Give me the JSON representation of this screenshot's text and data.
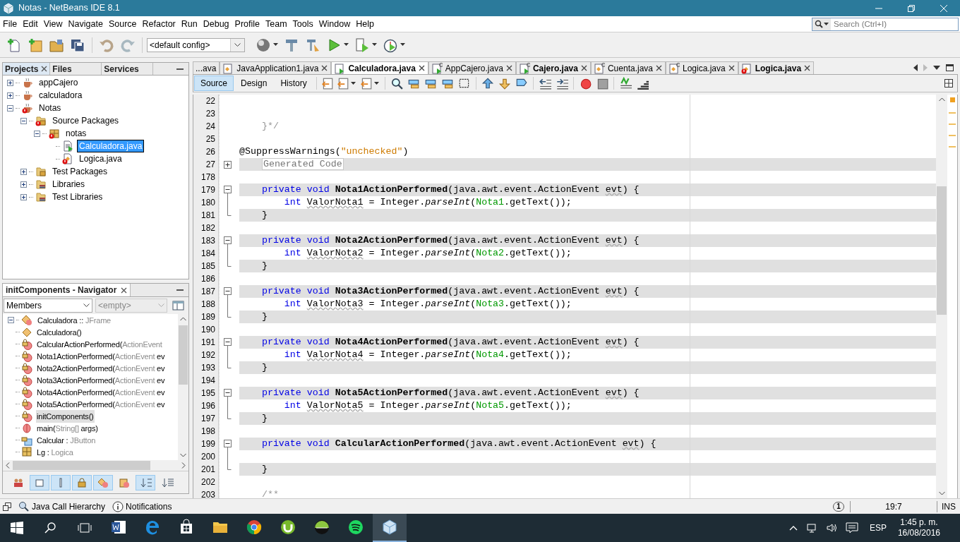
{
  "window": {
    "title": "Notas - NetBeans IDE 8.1"
  },
  "menu": [
    "File",
    "Edit",
    "View",
    "Navigate",
    "Source",
    "Refactor",
    "Run",
    "Debug",
    "Profile",
    "Team",
    "Tools",
    "Window",
    "Help"
  ],
  "search": {
    "placeholder": "Search (Ctrl+I)"
  },
  "toolbar": {
    "config": "<default config>"
  },
  "projects_panel": {
    "tabs": [
      {
        "label": "Projects",
        "selected": true
      },
      {
        "label": "Files",
        "selected": false
      },
      {
        "label": "Services",
        "selected": false
      }
    ],
    "tree": [
      {
        "label": "appCajero",
        "kind": "project",
        "expanded": false,
        "selected": false,
        "error": false
      },
      {
        "label": "calculadora",
        "kind": "project",
        "expanded": false,
        "selected": false,
        "error": false
      },
      {
        "label": "Notas",
        "kind": "project",
        "expanded": true,
        "selected": false,
        "error": true,
        "children": [
          {
            "label": "Source Packages",
            "kind": "source_packages",
            "expanded": true,
            "selected": false,
            "error": true,
            "children": [
              {
                "label": "notas",
                "kind": "package",
                "expanded": true,
                "selected": false,
                "error": true,
                "children": [
                  {
                    "label": "Calculadora.java",
                    "kind": "form",
                    "selected": true,
                    "error": false
                  },
                  {
                    "label": "Logica.java",
                    "kind": "java",
                    "selected": false,
                    "error": true
                  }
                ]
              }
            ]
          },
          {
            "label": "Test Packages",
            "kind": "test_packages",
            "expanded": false,
            "selected": false,
            "error": false
          },
          {
            "label": "Libraries",
            "kind": "libraries",
            "expanded": false,
            "selected": false,
            "error": false
          },
          {
            "label": "Test Libraries",
            "kind": "libraries",
            "expanded": false,
            "selected": false,
            "error": false
          }
        ]
      }
    ]
  },
  "navigator": {
    "title": "initComponents - Navigator",
    "filter": "Members",
    "secondary": "<empty>",
    "root": {
      "parts": [
        {
          "text": "Calculadora :: ",
          "kind": "plain"
        },
        {
          "text": "JFrame",
          "kind": "type"
        }
      ],
      "kind": "class",
      "expanded": true,
      "children": [
        {
          "parts": [
            {
              "text": "Calculadora()",
              "kind": "plain"
            }
          ],
          "kind": "constructor",
          "selected": false
        },
        {
          "parts": [
            {
              "text": "CalcularActionPerformed(",
              "kind": "plain"
            },
            {
              "text": "ActionEvent",
              "kind": "type"
            }
          ],
          "kind": "private_method",
          "selected": false
        },
        {
          "parts": [
            {
              "text": "Nota1ActionPerformed(",
              "kind": "plain"
            },
            {
              "text": "ActionEvent",
              "kind": "type"
            },
            {
              "text": " ev",
              "kind": "plain"
            }
          ],
          "kind": "private_method",
          "selected": false
        },
        {
          "parts": [
            {
              "text": "Nota2ActionPerformed(",
              "kind": "plain"
            },
            {
              "text": "ActionEvent",
              "kind": "type"
            },
            {
              "text": " ev",
              "kind": "plain"
            }
          ],
          "kind": "private_method",
          "selected": false
        },
        {
          "parts": [
            {
              "text": "Nota3ActionPerformed(",
              "kind": "plain"
            },
            {
              "text": "ActionEvent",
              "kind": "type"
            },
            {
              "text": " ev",
              "kind": "plain"
            }
          ],
          "kind": "private_method",
          "selected": false
        },
        {
          "parts": [
            {
              "text": "Nota4ActionPerformed(",
              "kind": "plain"
            },
            {
              "text": "ActionEvent",
              "kind": "type"
            },
            {
              "text": " ev",
              "kind": "plain"
            }
          ],
          "kind": "private_method",
          "selected": false
        },
        {
          "parts": [
            {
              "text": "Nota5ActionPerformed(",
              "kind": "plain"
            },
            {
              "text": "ActionEvent",
              "kind": "type"
            },
            {
              "text": " ev",
              "kind": "plain"
            }
          ],
          "kind": "private_method",
          "selected": false
        },
        {
          "parts": [
            {
              "text": "initComponents()",
              "kind": "plain"
            }
          ],
          "kind": "private_method",
          "selected": true
        },
        {
          "parts": [
            {
              "text": "main(",
              "kind": "plain"
            },
            {
              "text": "String[]",
              "kind": "type"
            },
            {
              "text": " args)",
              "kind": "plain"
            }
          ],
          "kind": "static_method",
          "selected": false
        },
        {
          "parts": [
            {
              "text": "Calcular : ",
              "kind": "plain"
            },
            {
              "text": "JButton",
              "kind": "type"
            }
          ],
          "kind": "private_field",
          "selected": false
        },
        {
          "parts": [
            {
              "text": "Lg : ",
              "kind": "plain"
            },
            {
              "text": "Logica",
              "kind": "type"
            }
          ],
          "kind": "field",
          "selected": false
        }
      ]
    },
    "filters": [
      {
        "kind": "inherited",
        "selected": false
      },
      {
        "kind": "fields",
        "selected": true
      },
      {
        "kind": "static",
        "selected": true
      },
      {
        "kind": "private",
        "selected": true
      },
      {
        "kind": "local_classes",
        "selected": true
      },
      {
        "kind": "javadoc",
        "selected": false
      },
      {
        "kind": "sort_name",
        "selected": true
      },
      {
        "kind": "sort_source",
        "selected": false
      }
    ]
  },
  "editor": {
    "tabs": [
      {
        "label": "...ava",
        "kind": "none",
        "selected": false,
        "bold": false
      },
      {
        "label": "JavaApplication1.java",
        "kind": "class",
        "selected": false,
        "bold": false
      },
      {
        "label": "Calculadora.java",
        "kind": "form",
        "selected": true,
        "bold": true
      },
      {
        "label": "AppCajero.java",
        "kind": "form_linked",
        "selected": false,
        "bold": false
      },
      {
        "label": "Cajero.java",
        "kind": "form_linked",
        "selected": false,
        "bold": true
      },
      {
        "label": "Cuenta.java",
        "kind": "class_linked",
        "selected": false,
        "bold": false
      },
      {
        "label": "Logica.java",
        "kind": "class_linked",
        "selected": false,
        "bold": false
      },
      {
        "label": "Logica.java",
        "kind": "class_error",
        "selected": false,
        "bold": true
      }
    ],
    "views": [
      {
        "label": "Source",
        "selected": true
      },
      {
        "label": "Design",
        "selected": false
      },
      {
        "label": "History",
        "selected": false
      }
    ],
    "lines": [
      {
        "n": "22",
        "kind": "none",
        "shaded": false
      },
      {
        "n": "23",
        "kind": "none",
        "shaded": false
      },
      {
        "n": "24",
        "kind": "none",
        "shaded": false,
        "tokens": [
          {
            "text": "    }*/",
            "kind": "comment"
          }
        ]
      },
      {
        "n": "25",
        "kind": "none",
        "shaded": false
      },
      {
        "n": "26",
        "kind": "none",
        "shaded": false,
        "tokens": [
          {
            "text": "@SuppressWarnings(",
            "kind": "plain"
          },
          {
            "text": "\"unchecked\"",
            "kind": "string"
          },
          {
            "text": ")",
            "kind": "plain"
          }
        ]
      },
      {
        "n": "27",
        "kind": "plus",
        "shaded": true,
        "tokens": [
          {
            "text": "    Generated Code",
            "kind": "folded"
          }
        ]
      },
      {
        "n": "178",
        "kind": "none",
        "shaded": false
      },
      {
        "n": "179",
        "kind": "minus",
        "shaded": true,
        "tokens": [
          {
            "text": "    private void ",
            "kind": "keyword"
          },
          {
            "text": "Nota1ActionPerformed",
            "kind": "method"
          },
          {
            "text": "(java.awt.event.ActionEvent ",
            "kind": "plain"
          },
          {
            "text": "evt",
            "kind": "unused"
          },
          {
            "text": ") {",
            "kind": "plain"
          }
        ]
      },
      {
        "n": "180",
        "kind": "line",
        "shaded": false,
        "tokens": [
          {
            "text": "        int ",
            "kind": "keyword"
          },
          {
            "text": "ValorNota1",
            "kind": "unused"
          },
          {
            "text": " = Integer.",
            "kind": "plain"
          },
          {
            "text": "parseInt",
            "kind": "italic"
          },
          {
            "text": "(",
            "kind": "plain"
          },
          {
            "text": "Nota1",
            "kind": "field"
          },
          {
            "text": ".getText());",
            "kind": "plain"
          }
        ]
      },
      {
        "n": "181",
        "kind": "end",
        "shaded": true,
        "tokens": [
          {
            "text": "    }",
            "kind": "plain"
          }
        ]
      },
      {
        "n": "182",
        "kind": "none",
        "shaded": false
      },
      {
        "n": "183",
        "kind": "minus",
        "shaded": true,
        "tokens": [
          {
            "text": "    private void ",
            "kind": "keyword"
          },
          {
            "text": "Nota2ActionPerformed",
            "kind": "method"
          },
          {
            "text": "(java.awt.event.ActionEvent ",
            "kind": "plain"
          },
          {
            "text": "evt",
            "kind": "unused"
          },
          {
            "text": ") {",
            "kind": "plain"
          }
        ]
      },
      {
        "n": "184",
        "kind": "line",
        "shaded": false,
        "tokens": [
          {
            "text": "        int ",
            "kind": "keyword"
          },
          {
            "text": "ValorNota2",
            "kind": "unused"
          },
          {
            "text": " = Integer.",
            "kind": "plain"
          },
          {
            "text": "parseInt",
            "kind": "italic"
          },
          {
            "text": "(",
            "kind": "plain"
          },
          {
            "text": "Nota2",
            "kind": "field"
          },
          {
            "text": ".getText());",
            "kind": "plain"
          }
        ]
      },
      {
        "n": "185",
        "kind": "end",
        "shaded": true,
        "tokens": [
          {
            "text": "    }",
            "kind": "plain"
          }
        ]
      },
      {
        "n": "186",
        "kind": "none",
        "shaded": false
      },
      {
        "n": "187",
        "kind": "minus",
        "shaded": true,
        "tokens": [
          {
            "text": "    private void ",
            "kind": "keyword"
          },
          {
            "text": "Nota3ActionPerformed",
            "kind": "method"
          },
          {
            "text": "(java.awt.event.ActionEvent ",
            "kind": "plain"
          },
          {
            "text": "evt",
            "kind": "unused"
          },
          {
            "text": ") {",
            "kind": "plain"
          }
        ]
      },
      {
        "n": "188",
        "kind": "line",
        "shaded": false,
        "tokens": [
          {
            "text": "        int ",
            "kind": "keyword"
          },
          {
            "text": "ValorNota3",
            "kind": "unused"
          },
          {
            "text": " = Integer.",
            "kind": "plain"
          },
          {
            "text": "parseInt",
            "kind": "italic"
          },
          {
            "text": "(",
            "kind": "plain"
          },
          {
            "text": "Nota3",
            "kind": "field"
          },
          {
            "text": ".getText());",
            "kind": "plain"
          }
        ]
      },
      {
        "n": "189",
        "kind": "end",
        "shaded": true,
        "tokens": [
          {
            "text": "    }",
            "kind": "plain"
          }
        ]
      },
      {
        "n": "190",
        "kind": "none",
        "shaded": false
      },
      {
        "n": "191",
        "kind": "minus",
        "shaded": true,
        "tokens": [
          {
            "text": "    private void ",
            "kind": "keyword"
          },
          {
            "text": "Nota4ActionPerformed",
            "kind": "method"
          },
          {
            "text": "(java.awt.event.ActionEvent ",
            "kind": "plain"
          },
          {
            "text": "evt",
            "kind": "unused"
          },
          {
            "text": ") {",
            "kind": "plain"
          }
        ]
      },
      {
        "n": "192",
        "kind": "line",
        "shaded": false,
        "tokens": [
          {
            "text": "        int ",
            "kind": "keyword"
          },
          {
            "text": "ValorNota4",
            "kind": "unused"
          },
          {
            "text": " = Integer.",
            "kind": "plain"
          },
          {
            "text": "parseInt",
            "kind": "italic"
          },
          {
            "text": "(",
            "kind": "plain"
          },
          {
            "text": "Nota4",
            "kind": "field"
          },
          {
            "text": ".getText());",
            "kind": "plain"
          }
        ]
      },
      {
        "n": "193",
        "kind": "end",
        "shaded": true,
        "tokens": [
          {
            "text": "    }",
            "kind": "plain"
          }
        ]
      },
      {
        "n": "194",
        "kind": "none",
        "shaded": false
      },
      {
        "n": "195",
        "kind": "minus",
        "shaded": true,
        "tokens": [
          {
            "text": "    private void ",
            "kind": "keyword"
          },
          {
            "text": "Nota5ActionPerformed",
            "kind": "method"
          },
          {
            "text": "(java.awt.event.ActionEvent ",
            "kind": "plain"
          },
          {
            "text": "evt",
            "kind": "unused"
          },
          {
            "text": ") {",
            "kind": "plain"
          }
        ]
      },
      {
        "n": "196",
        "kind": "line",
        "shaded": false,
        "tokens": [
          {
            "text": "        int ",
            "kind": "keyword"
          },
          {
            "text": "ValorNota5",
            "kind": "unused"
          },
          {
            "text": " = Integer.",
            "kind": "plain"
          },
          {
            "text": "parseInt",
            "kind": "italic"
          },
          {
            "text": "(",
            "kind": "plain"
          },
          {
            "text": "Nota5",
            "kind": "field"
          },
          {
            "text": ".getText());",
            "kind": "plain"
          }
        ]
      },
      {
        "n": "197",
        "kind": "end",
        "shaded": true,
        "tokens": [
          {
            "text": "    }",
            "kind": "plain"
          }
        ]
      },
      {
        "n": "198",
        "kind": "none",
        "shaded": false
      },
      {
        "n": "199",
        "kind": "minus",
        "shaded": true,
        "tokens": [
          {
            "text": "    private void ",
            "kind": "keyword"
          },
          {
            "text": "CalcularActionPerformed",
            "kind": "method"
          },
          {
            "text": "(java.awt.event.ActionEvent ",
            "kind": "plain"
          },
          {
            "text": "evt",
            "kind": "unused"
          },
          {
            "text": ") {",
            "kind": "plain"
          }
        ]
      },
      {
        "n": "200",
        "kind": "line",
        "shaded": false
      },
      {
        "n": "201",
        "kind": "end",
        "shaded": true,
        "tokens": [
          {
            "text": "    }",
            "kind": "plain"
          }
        ]
      },
      {
        "n": "202",
        "kind": "none",
        "shaded": false
      },
      {
        "n": "203",
        "kind": "none",
        "shaded": false,
        "tokens": [
          {
            "text": "    /**",
            "kind": "comment"
          }
        ]
      }
    ]
  },
  "status_bar": {
    "items": [
      "Java Call Hierarchy",
      "Notifications"
    ],
    "badge": "1",
    "position": "19:7",
    "mode": "INS"
  },
  "taskbar": {
    "apps": [
      {
        "kind": "word",
        "selected": false
      },
      {
        "kind": "edge",
        "selected": false
      },
      {
        "kind": "store",
        "selected": false
      },
      {
        "kind": "explorer",
        "selected": false
      },
      {
        "kind": "chrome",
        "selected": false
      },
      {
        "kind": "utorrent",
        "selected": false
      },
      {
        "kind": "sphere",
        "selected": false
      },
      {
        "kind": "spotify",
        "selected": false
      },
      {
        "kind": "netbeans",
        "selected": true
      }
    ],
    "language": "ESP",
    "time": "1:45 p. m.",
    "date": "16/08/2016"
  }
}
